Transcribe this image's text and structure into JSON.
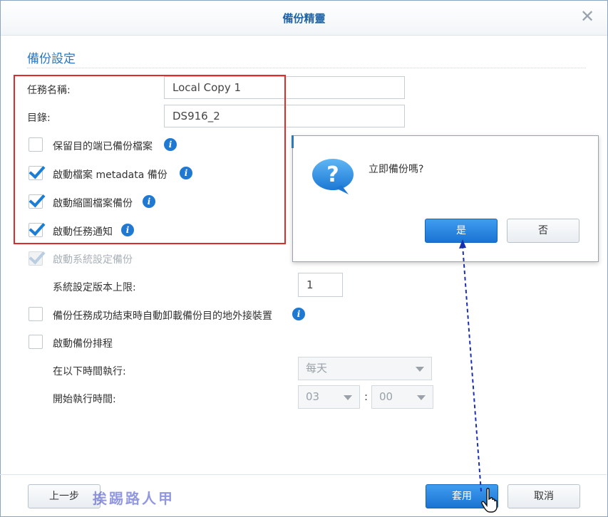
{
  "window": {
    "title": "備份精靈"
  },
  "section": {
    "title": "備份設定"
  },
  "form": {
    "task_name_label": "任務名稱:",
    "task_name_value": "Local Copy 1",
    "directory_label": "目錄:",
    "directory_value": "DS916_2",
    "options": [
      {
        "label": "保留目的端已備份檔案",
        "checked": false,
        "info": true
      },
      {
        "label": "啟動檔案 metadata 備份",
        "checked": true,
        "info": true
      },
      {
        "label": "啟動縮圖檔案備份",
        "checked": true,
        "info": true
      },
      {
        "label": "啟動任務通知",
        "checked": true,
        "info": true
      },
      {
        "label": "啟動系統設定備份",
        "checked": true,
        "disabled": true
      }
    ],
    "config_version_label": "系統設定版本上限:",
    "config_version_value": "1",
    "auto_unmount_label": "備份任務成功結束時自動卸載備份目的地外接裝置",
    "schedule_label": "啟動備份排程",
    "run_at_label": "在以下時間執行:",
    "run_at_value": "每天",
    "start_time_label": "開始執行時間:",
    "start_hour": "03",
    "start_minute": "00",
    "time_separator": ":"
  },
  "dialog": {
    "message": "立即備份嗎?",
    "yes_label": "是",
    "no_label": "否"
  },
  "footer": {
    "back_label": "上一步",
    "apply_label": "套用",
    "cancel_label": "取消",
    "watermark": "挨踢路人甲"
  },
  "colors": {
    "accent": "#1a7ed8",
    "title": "#1f64a8",
    "highlight": "#e02b2b",
    "arrow": "#1a2fb0"
  }
}
